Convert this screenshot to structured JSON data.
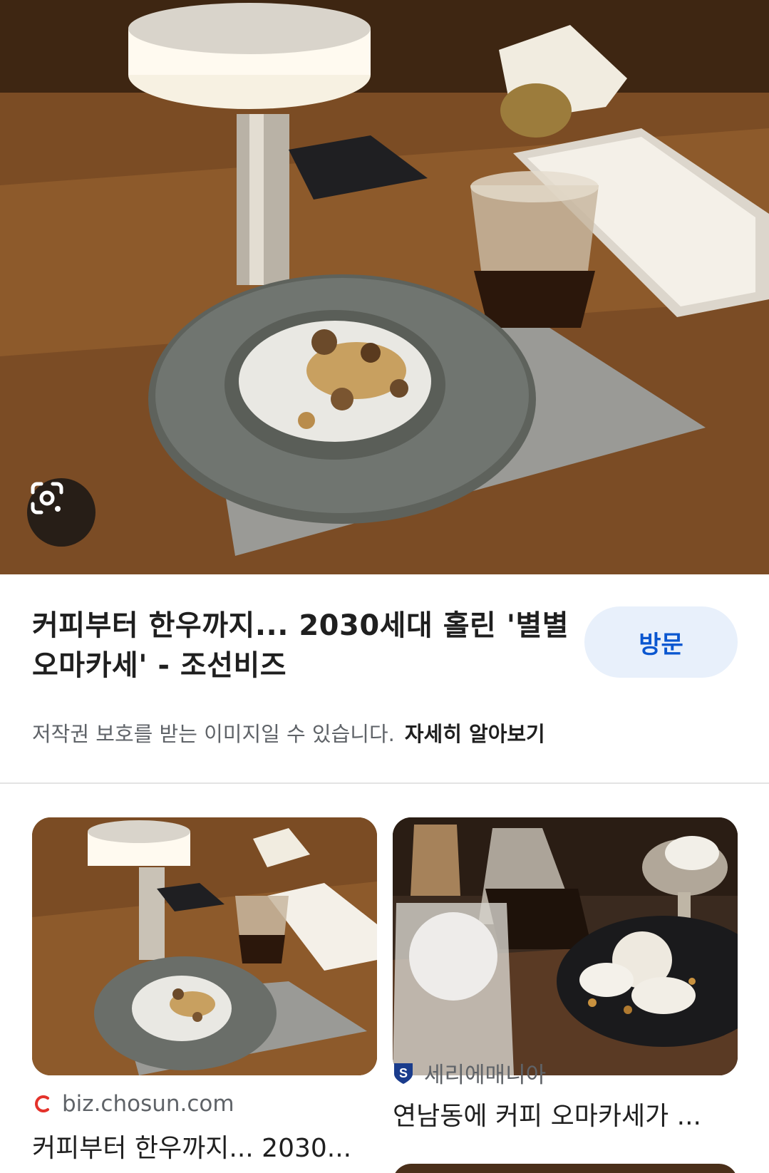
{
  "result": {
    "title": "커피부터 한우까지... 2030세대 홀린 '별별 오마카세' - 조선비즈",
    "visit_label": "방문",
    "copyright_notice": "저작권 보호를 받는 이미지일 수 있습니다.",
    "learn_more_label": "자세히 알아보기"
  },
  "related": [
    {
      "source": "biz.chosun.com",
      "title": "커피부터 한우까지... 2030..."
    },
    {
      "source": "세리에매니아",
      "title": "연남동에 커피 오마카세가 ..."
    }
  ],
  "colors": {
    "accent": "#0b57d0",
    "visit_bg": "#e8f0fb",
    "text": "#1f1f1f",
    "muted": "#5f6368"
  },
  "icons": {
    "lens": "google-lens-icon",
    "source1": "chosun-logo-icon",
    "source2": "seriemania-shield-icon"
  }
}
